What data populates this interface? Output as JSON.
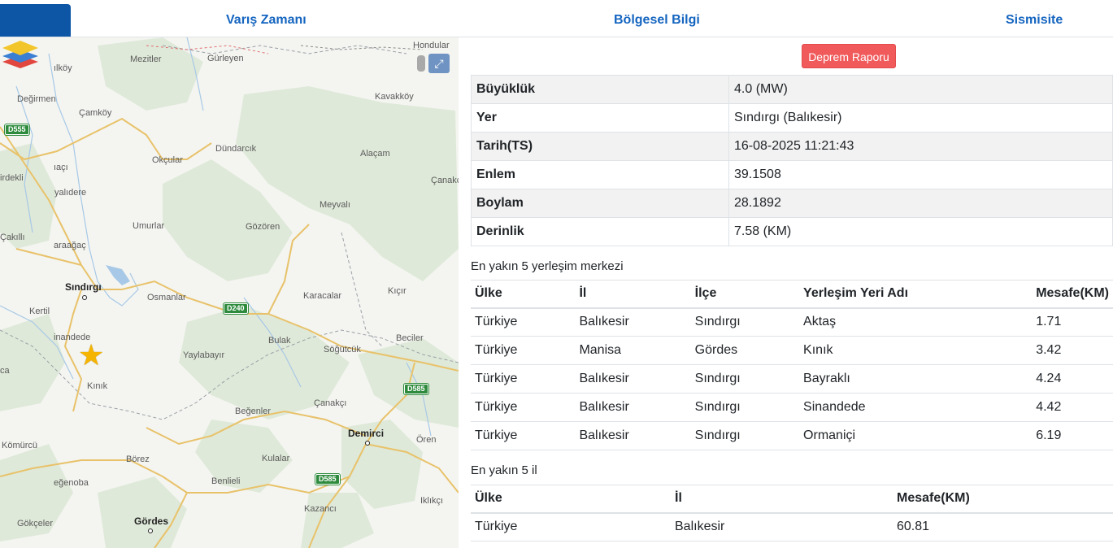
{
  "tabs": [
    {
      "label": ""
    },
    {
      "label": "Varış Zamanı"
    },
    {
      "label": "Bölgesel Bilgi"
    },
    {
      "label": "Sismisite"
    }
  ],
  "map": {
    "labels": [
      "Hondular",
      "ılköy",
      "Mezitler",
      "Gürleyen",
      "Değirmen",
      "Çamköy",
      "Kavakköy",
      "Okçular",
      "Dündarcık",
      "Alaçam",
      "ıaçı",
      "irdekli",
      "yalıdere",
      "Çanakç",
      "Umurlar",
      "Gözören",
      "Meyvalı",
      "Çakıllı",
      "araağaç",
      "Osmanlar",
      "Karacalar",
      "Kıçır",
      "Kertil",
      "inandede",
      "Bulak",
      "Söğütcük",
      "Beciler",
      "Yaylabayır",
      "ca",
      "Kınık",
      "Çanakçı",
      "Beğenler",
      "Kömürcü",
      "Ören",
      "Börez",
      "Kulalar",
      "eğenoba",
      "Benlieli",
      "Kazancı",
      "Iklıkçı",
      "Gökçeler"
    ],
    "towns": [
      "Sındırgı",
      "Demirci",
      "Gördes"
    ],
    "road_shields": [
      "D555",
      "D240",
      "D585",
      "D585"
    ],
    "expand_icon": "expand-arrows-icon",
    "layers_icon": "layers-icon",
    "epicenter_icon": "star-icon",
    "colors": {
      "land": "#f4f5f1",
      "forest": "#dfe9d9",
      "road": "#e8c26a",
      "water": "#a7c8e6",
      "border": "#9aa0a6"
    }
  },
  "report_button": "Deprem Raporu",
  "info": [
    {
      "k": "Büyüklük",
      "v": "4.0 (MW)"
    },
    {
      "k": "Yer",
      "v": "Sındırgı (Balıkesir)"
    },
    {
      "k": "Tarih(TS)",
      "v": "16-08-2025 11:21:43"
    },
    {
      "k": "Enlem",
      "v": "39.1508"
    },
    {
      "k": "Boylam",
      "v": "28.1892"
    },
    {
      "k": "Derinlik",
      "v": "7.58 (KM)"
    }
  ],
  "settlements": {
    "title": "En yakın 5 yerleşim merkezi",
    "headers": [
      "Ülke",
      "İl",
      "İlçe",
      "Yerleşim Yeri Adı",
      "Mesafe(KM)"
    ],
    "rows": [
      [
        "Türkiye",
        "Balıkesir",
        "Sındırgı",
        "Aktaş",
        "1.71"
      ],
      [
        "Türkiye",
        "Manisa",
        "Gördes",
        "Kınık",
        "3.42"
      ],
      [
        "Türkiye",
        "Balıkesir",
        "Sındırgı",
        "Bayraklı",
        "4.24"
      ],
      [
        "Türkiye",
        "Balıkesir",
        "Sındırgı",
        "Sinandede",
        "4.42"
      ],
      [
        "Türkiye",
        "Balıkesir",
        "Sındırgı",
        "Ormaniçi",
        "6.19"
      ]
    ]
  },
  "provinces": {
    "title": "En yakın 5 il",
    "headers": [
      "Ülke",
      "İl",
      "Mesafe(KM)"
    ],
    "rows": [
      [
        "Türkiye",
        "Balıkesir",
        "60.81"
      ]
    ]
  }
}
